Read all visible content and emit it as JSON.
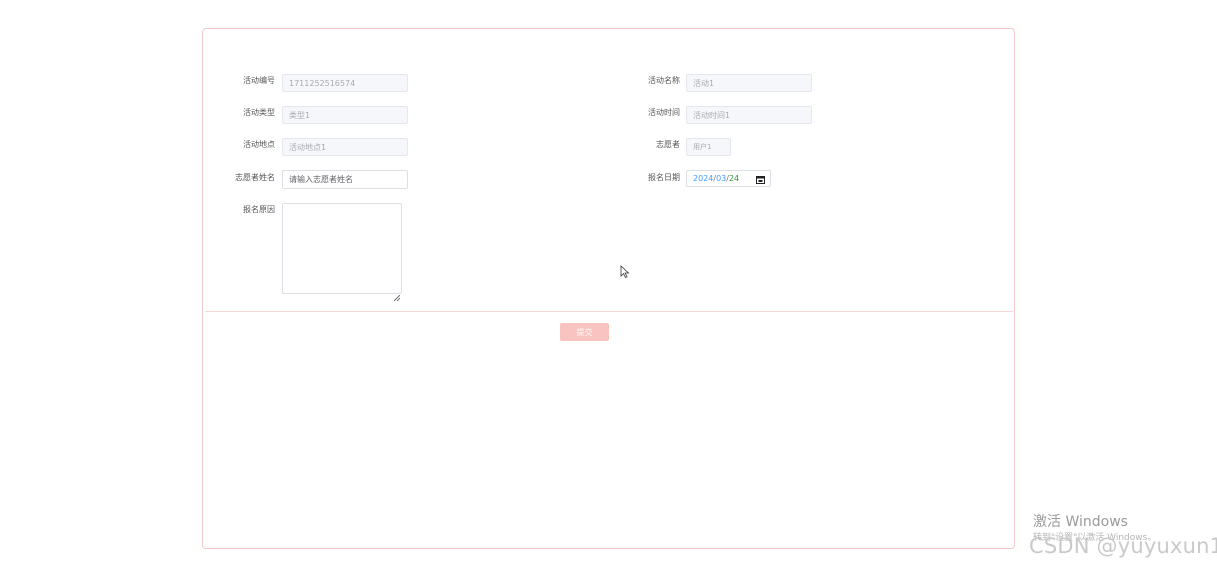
{
  "form": {
    "activity_no": {
      "label": "活动编号",
      "value": "1711252516574"
    },
    "activity_name": {
      "label": "活动名称",
      "value": "活动1"
    },
    "activity_type": {
      "label": "活动类型",
      "value": "类型1"
    },
    "activity_time": {
      "label": "活动时间",
      "value": "活动时间1"
    },
    "activity_place": {
      "label": "活动地点",
      "value": "活动地点1"
    },
    "volunteer": {
      "label": "志愿者",
      "value": "用户1"
    },
    "volunteer_name": {
      "label": "志愿者姓名",
      "placeholder": "请输入志愿者姓名"
    },
    "signup_date": {
      "label": "报名日期",
      "year": "2024",
      "month": "03",
      "day": "24",
      "sep": "/"
    },
    "signup_reason": {
      "label": "报名原因"
    }
  },
  "submit_label": "提交",
  "watermark": {
    "line1": "激活 Windows",
    "line2": "转到\"设置\"以激活 Windows。",
    "csdn": "CSDN @yuyuxun1"
  }
}
